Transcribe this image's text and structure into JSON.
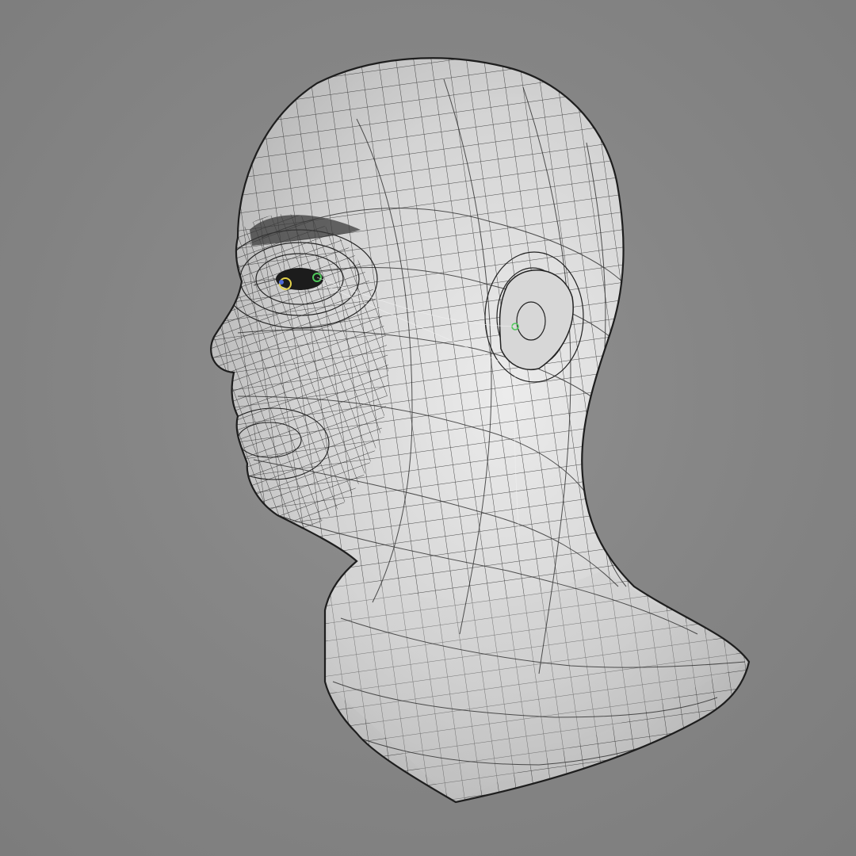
{
  "scene": {
    "subject": "wireframe-head-mesh",
    "background_color": "#878787",
    "mesh_fill_color": "#d6d6d6",
    "wire_color": "#2b2b2b",
    "shadow_color": "#9a9a9a"
  }
}
